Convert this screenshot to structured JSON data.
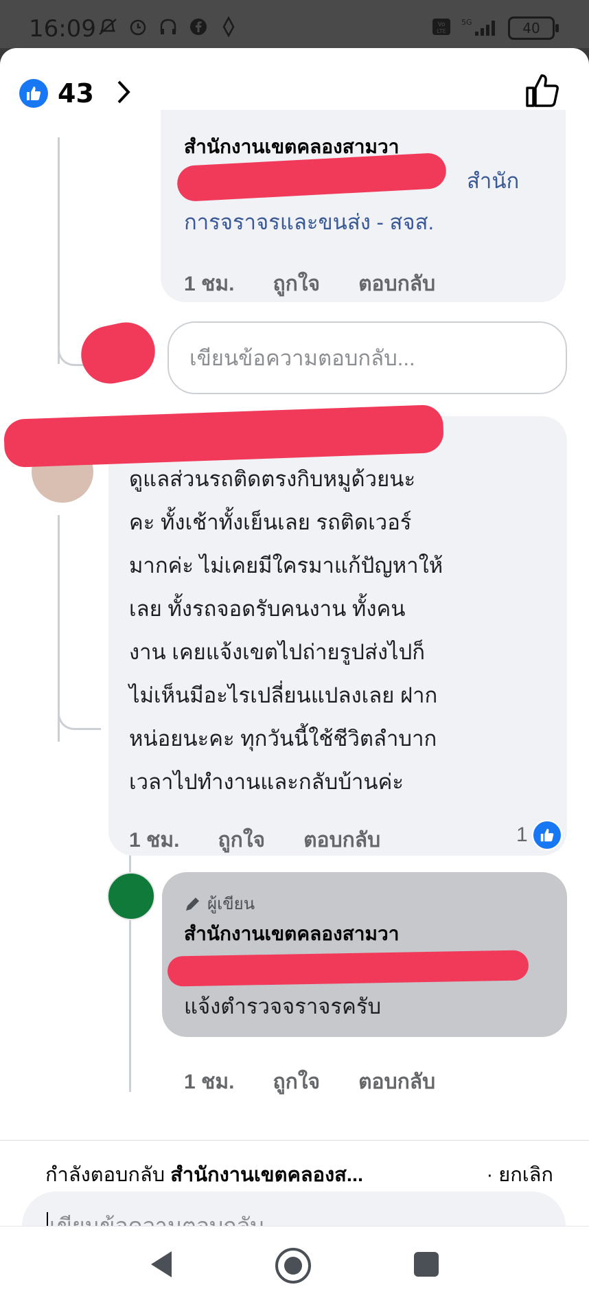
{
  "status_bar": {
    "time": "16:09",
    "battery": "40"
  },
  "header": {
    "reaction_count": "43"
  },
  "comment1": {
    "author": "สำนักงานเขตคลองสามวา",
    "text_line1_tail": "สำนัก",
    "text_line2": "การจราจรและขนส่ง - สจส.",
    "time": "1 ชม.",
    "like": "ถูกใจ",
    "reply": "ตอบกลับ"
  },
  "reply_input_1": {
    "placeholder": "เขียนข้อความตอบกลับ..."
  },
  "comment2": {
    "lines": [
      "ดูแลส่วนรถติดตรงกิบหมูด้วยนะ",
      "คะ ทั้งเช้าทั้งเย็นเลย รถติดเวอร์",
      "มากค่ะ ไม่เคยมีใครมาแก้ปัญหาให้",
      "เลย ทั้งรถจอดรับคนงาน ทั้งคน",
      "งาน  เคยแจ้งเขตไปถ่ายรูปส่งไปก็",
      "ไม่เห็นมีอะไรเปลี่ยนแปลงเลย ฝาก",
      "หน่อยนะคะ ทุกวันนี้ใช้ชีวิตลำบาก",
      "เวลาไปทำงานและกลับบ้านค่ะ"
    ],
    "time": "1 ชม.",
    "like": "ถูกใจ",
    "reply": "ตอบกลับ",
    "like_count": "1"
  },
  "comment3": {
    "badge": "ผู้เขียน",
    "author": "สำนักงานเขตคลองสามวา",
    "text": "แจ้งตำรวจจราจรครับ",
    "time": "1 ชม.",
    "like": "ถูกใจ",
    "reply": "ตอบกลับ"
  },
  "replying": {
    "prefix": "กำลังตอบกลับ",
    "target": "สำนักงานเขตคลองส...",
    "cancel": "· ยกเลิก"
  },
  "composer": {
    "placeholder": "เขียนข้อความตอบกลับ..."
  },
  "colors": {
    "facebook_blue": "#1877f2",
    "redaction": "#f13a5a"
  }
}
